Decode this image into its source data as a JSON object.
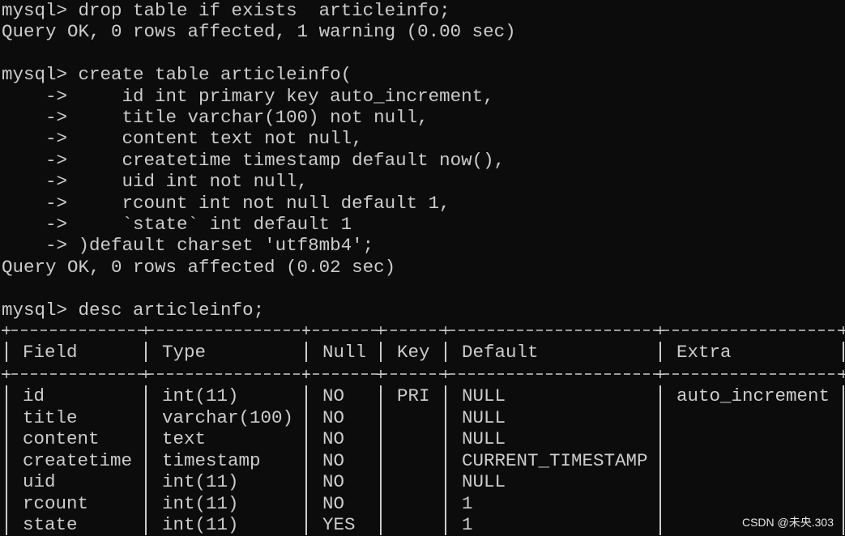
{
  "prompt": "mysql>",
  "continuation": "->",
  "commands": {
    "drop": "drop table if exists  articleinfo;",
    "drop_result": "Query OK, 0 rows affected, 1 warning (0.00 sec)",
    "create": "create table articleinfo(",
    "create_lines": [
      "id int primary key auto_increment,",
      "title varchar(100) not null,",
      "content text not null,",
      "createtime timestamp default now(),",
      "uid int not null,",
      "rcount int not null default 1,",
      "`state` int default 1"
    ],
    "create_end": ")default charset 'utf8mb4';",
    "create_result": "Query OK, 0 rows affected (0.02 sec)",
    "desc": "desc articleinfo;"
  },
  "table": {
    "headers": [
      "Field",
      "Type",
      "Null",
      "Key",
      "Default",
      "Extra"
    ],
    "rows": [
      [
        "id",
        "int(11)",
        "NO",
        "PRI",
        "NULL",
        "auto_increment"
      ],
      [
        "title",
        "varchar(100)",
        "NO",
        "",
        "NULL",
        ""
      ],
      [
        "content",
        "text",
        "NO",
        "",
        "NULL",
        ""
      ],
      [
        "createtime",
        "timestamp",
        "NO",
        "",
        "CURRENT_TIMESTAMP",
        ""
      ],
      [
        "uid",
        "int(11)",
        "NO",
        "",
        "NULL",
        ""
      ],
      [
        "rcount",
        "int(11)",
        "NO",
        "",
        "1",
        ""
      ],
      [
        "state",
        "int(11)",
        "YES",
        "",
        "1",
        ""
      ]
    ]
  },
  "watermark": "CSDN @未央.303",
  "colors": {
    "background": "#0c0c0c",
    "text": "#cccccc"
  }
}
